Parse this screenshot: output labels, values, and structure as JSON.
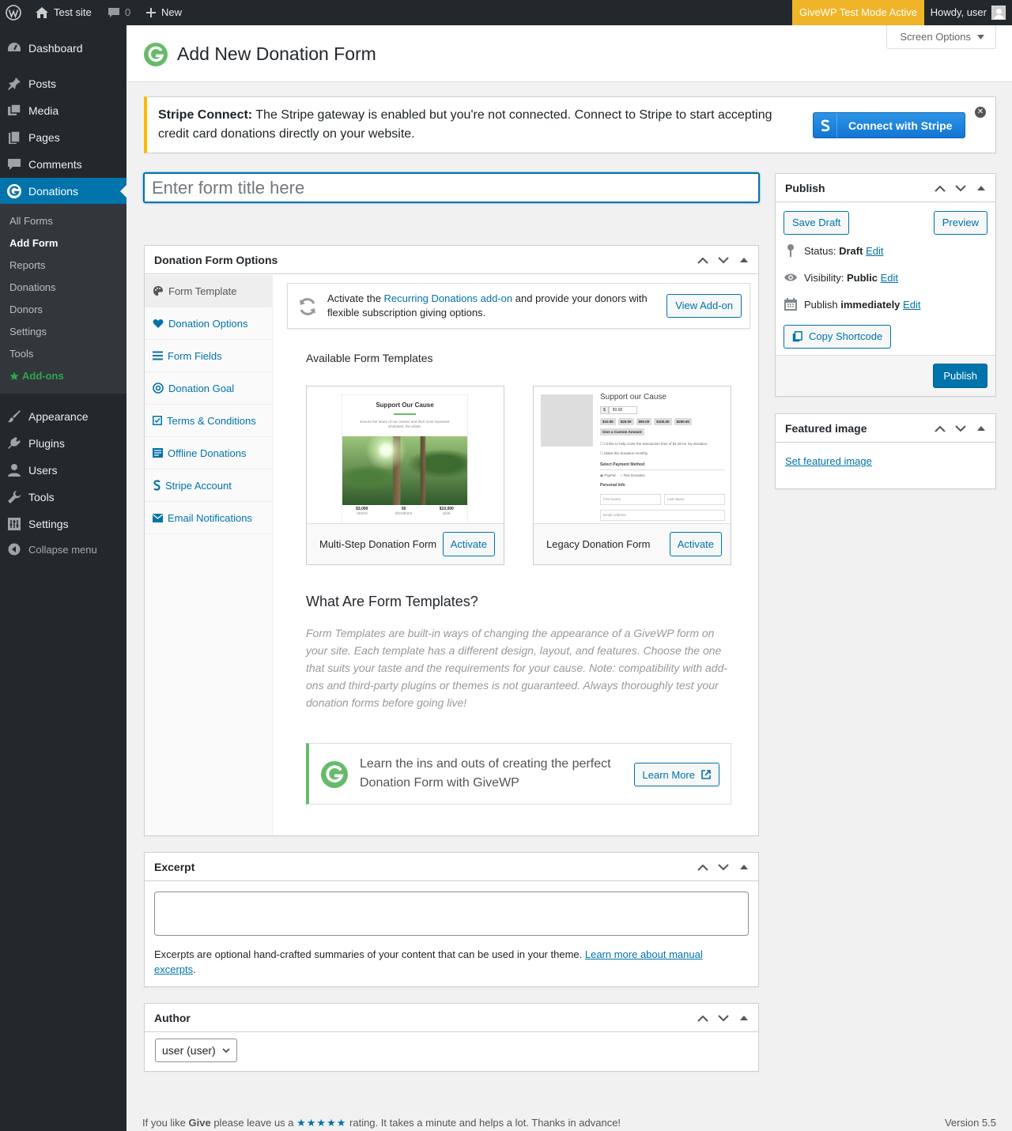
{
  "adminbar": {
    "site_name": "Test site",
    "comments_count": "0",
    "new_label": "New",
    "test_mode": "GiveWP Test Mode Active",
    "howdy": "Howdy, user"
  },
  "sidebar": {
    "items": [
      {
        "label": "Dashboard",
        "icon": "dashboard-icon"
      },
      {
        "label": "Posts",
        "icon": "pin-icon"
      },
      {
        "label": "Media",
        "icon": "media-icon"
      },
      {
        "label": "Pages",
        "icon": "pages-icon"
      },
      {
        "label": "Comments",
        "icon": "comment-icon"
      },
      {
        "label": "Donations",
        "icon": "givewp-icon"
      },
      {
        "label": "Appearance",
        "icon": "brush-icon"
      },
      {
        "label": "Plugins",
        "icon": "plug-icon"
      },
      {
        "label": "Users",
        "icon": "user-icon"
      },
      {
        "label": "Tools",
        "icon": "wrench-icon"
      },
      {
        "label": "Settings",
        "icon": "settings-icon"
      }
    ],
    "submenu": [
      "All Forms",
      "Add Form",
      "Reports",
      "Donations",
      "Donors",
      "Settings",
      "Tools",
      "Add-ons"
    ],
    "collapse": "Collapse menu"
  },
  "header": {
    "title": "Add New Donation Form",
    "screen_options": "Screen Options"
  },
  "notice": {
    "bold": "Stripe Connect:",
    "text": " The Stripe gateway is enabled but you're not connected. Connect to Stripe to start accepting credit card donations directly on your website.",
    "button": "Connect with Stripe"
  },
  "title_input": {
    "placeholder": "Enter form title here",
    "value": ""
  },
  "form_options": {
    "heading": "Donation Form Options",
    "tabs": [
      "Form Template",
      "Donation Options",
      "Form Fields",
      "Donation Goal",
      "Terms & Conditions",
      "Offline Donations",
      "Stripe Account",
      "Email Notifications"
    ],
    "addon_notice": {
      "pre": "Activate the ",
      "link": "Recurring Donations add-on",
      "post": " and provide your donors with flexible subscription giving options.",
      "button": "View Add-on"
    },
    "available_title": "Available Form Templates",
    "templates": [
      {
        "name": "Multi-Step Donation Form",
        "button": "Activate",
        "preview_title": "Support Our Cause",
        "preview_sub": "Ensure the future of our oceans and their most important inhabitant, the whale.",
        "stats": [
          {
            "value": "$3,000",
            "label": "raised"
          },
          {
            "value": "50",
            "label": "donations"
          },
          {
            "value": "$10,000",
            "label": "goal"
          }
        ]
      },
      {
        "name": "Legacy Donation Form",
        "button": "Activate",
        "preview_title": "Support our Cause",
        "amount": "50.00",
        "levels": [
          "$10.00",
          "$25.00",
          "$50.00",
          "$100.00",
          "$250.00"
        ],
        "custom": "Give a Custom Amount",
        "cover_fees": "I'd like to help cover the transaction fees of $1.00 for my donation.",
        "monthly": "Make this donation monthly",
        "payment_heading": "Select Payment Method",
        "methods": [
          "PayPal",
          "Test Donation"
        ],
        "personal_heading": "Personal Info",
        "first_name": "First Name",
        "last_name": "Last Name",
        "email": "Email Address"
      }
    ],
    "what_title": "What Are Form Templates?",
    "what_text": "Form Templates are built-in ways of changing the appearance of a GiveWP form on your site. Each template has a different design, layout, and features. Choose the one that suits your taste and the requirements for your cause. Note: compatibility with add-ons and third-party plugins or themes is not guaranteed. Always thoroughly test your donation forms before going live!",
    "learn_text": "Learn the ins and outs of creating the perfect Donation Form with GiveWP",
    "learn_button": "Learn More"
  },
  "publish": {
    "heading": "Publish",
    "save_draft": "Save Draft",
    "preview": "Preview",
    "status_label": "Status:",
    "status_value": "Draft",
    "visibility_label": "Visibility:",
    "visibility_value": "Public",
    "publish_label": "Publish",
    "publish_value": "immediately",
    "edit": "Edit",
    "copy_shortcode": "Copy Shortcode",
    "publish_button": "Publish"
  },
  "featured": {
    "heading": "Featured image",
    "link": "Set featured image"
  },
  "excerpt": {
    "heading": "Excerpt",
    "help": "Excerpts are optional hand-crafted summaries of your content that can be used in your theme. ",
    "link": "Learn more about manual excerpts",
    "period": "."
  },
  "author": {
    "heading": "Author",
    "selected": "user (user)"
  },
  "footer": {
    "pre": "If you like ",
    "brand": "Give",
    "mid": " please leave us a ",
    "stars": "★★★★★",
    "post": " rating. It takes a minute and helps a lot. Thanks in advance!",
    "version": "Version 5.5"
  }
}
